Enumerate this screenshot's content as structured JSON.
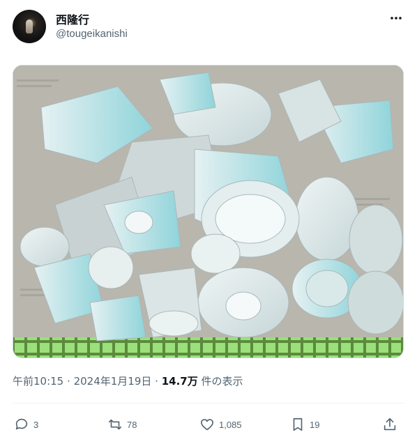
{
  "post": {
    "author_name": "西隆行",
    "author_handle": "@tougeikanishi",
    "image_alt": "Photo of broken celadon porcelain pieces in a green crate",
    "time": "午前10:15",
    "sep1": "·",
    "date": "2024年1月19日",
    "sep2": "·",
    "views": "14.7万",
    "views_suffix": "件の表示"
  },
  "actions": {
    "replies": "3",
    "reposts": "78",
    "likes": "1,085",
    "bookmarks": "19"
  },
  "icons": {
    "more": "more-icon",
    "reply": "reply-icon",
    "repost": "repost-icon",
    "like": "heart-icon",
    "bookmark": "bookmark-icon",
    "share": "share-icon"
  },
  "colors": {
    "text": "#0f1419",
    "secondary": "#536471",
    "crate_green": "#8fcf6a",
    "porcelain": "#dfe9ea",
    "celadon": "#7fd0d6"
  }
}
